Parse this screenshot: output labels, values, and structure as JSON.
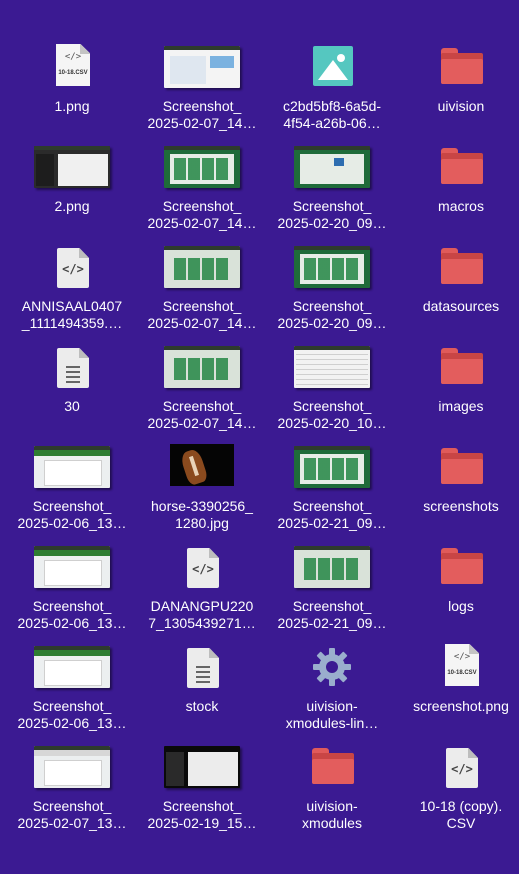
{
  "colors": {
    "desktop_bg": "#3b1a92",
    "folder": "#e35d5d",
    "image_icon": "#55c7c0"
  },
  "desktop": {
    "items": [
      {
        "line1": "1.png",
        "line2": "",
        "icon": "csv-preview-icon",
        "preview_label": "10-18.CSV"
      },
      {
        "line1": "Screenshot_",
        "line2": "2025-02-07_14…",
        "icon": "screenshot-thumbnail"
      },
      {
        "line1": "c2bd5bf8-6a5d-",
        "line2": "4f54-a26b-06…",
        "icon": "image-icon"
      },
      {
        "line1": "uivision",
        "line2": "",
        "icon": "folder-icon"
      },
      {
        "line1": "2.png",
        "line2": "",
        "icon": "screenshot-thumbnail"
      },
      {
        "line1": "Screenshot_",
        "line2": "2025-02-07_14…",
        "icon": "screenshot-thumbnail"
      },
      {
        "line1": "Screenshot_",
        "line2": "2025-02-20_09…",
        "icon": "screenshot-thumbnail"
      },
      {
        "line1": "macros",
        "line2": "",
        "icon": "folder-icon"
      },
      {
        "line1": "ANNISAAL0407",
        "line2": "_1111494359.…",
        "icon": "code-file-icon"
      },
      {
        "line1": "Screenshot_",
        "line2": "2025-02-07_14…",
        "icon": "screenshot-thumbnail"
      },
      {
        "line1": "Screenshot_",
        "line2": "2025-02-20_09…",
        "icon": "screenshot-thumbnail"
      },
      {
        "line1": "datasources",
        "line2": "",
        "icon": "folder-icon"
      },
      {
        "line1": "30",
        "line2": "",
        "icon": "text-file-icon"
      },
      {
        "line1": "Screenshot_",
        "line2": "2025-02-07_14…",
        "icon": "screenshot-thumbnail"
      },
      {
        "line1": "Screenshot_",
        "line2": "2025-02-20_10…",
        "icon": "screenshot-thumbnail"
      },
      {
        "line1": "images",
        "line2": "",
        "icon": "folder-icon"
      },
      {
        "line1": "Screenshot_",
        "line2": "2025-02-06_13…",
        "icon": "screenshot-thumbnail"
      },
      {
        "line1": "horse-3390256_",
        "line2": "1280.jpg",
        "icon": "horse-photo-thumbnail"
      },
      {
        "line1": "Screenshot_",
        "line2": "2025-02-21_09…",
        "icon": "screenshot-thumbnail"
      },
      {
        "line1": "screenshots",
        "line2": "",
        "icon": "folder-icon"
      },
      {
        "line1": "Screenshot_",
        "line2": "2025-02-06_13…",
        "icon": "screenshot-thumbnail"
      },
      {
        "line1": "DANANGPU220",
        "line2": "7_1305439271…",
        "icon": "code-file-icon"
      },
      {
        "line1": "Screenshot_",
        "line2": "2025-02-21_09…",
        "icon": "screenshot-thumbnail"
      },
      {
        "line1": "logs",
        "line2": "",
        "icon": "folder-icon"
      },
      {
        "line1": "Screenshot_",
        "line2": "2025-02-06_13…",
        "icon": "screenshot-thumbnail"
      },
      {
        "line1": "stock",
        "line2": "",
        "icon": "text-file-icon"
      },
      {
        "line1": "uivision-",
        "line2": "xmodules-lin…",
        "icon": "gear-icon"
      },
      {
        "line1": "screenshot.png",
        "line2": "",
        "icon": "csv-preview-icon",
        "preview_label": "10-18.CSV"
      },
      {
        "line1": "Screenshot_",
        "line2": "2025-02-07_13…",
        "icon": "screenshot-thumbnail"
      },
      {
        "line1": "Screenshot_",
        "line2": "2025-02-19_15…",
        "icon": "screenshot-thumbnail"
      },
      {
        "line1": "uivision-",
        "line2": "xmodules",
        "icon": "folder-icon"
      },
      {
        "line1": "10-18 (copy).",
        "line2": "CSV",
        "icon": "code-file-icon"
      }
    ]
  }
}
